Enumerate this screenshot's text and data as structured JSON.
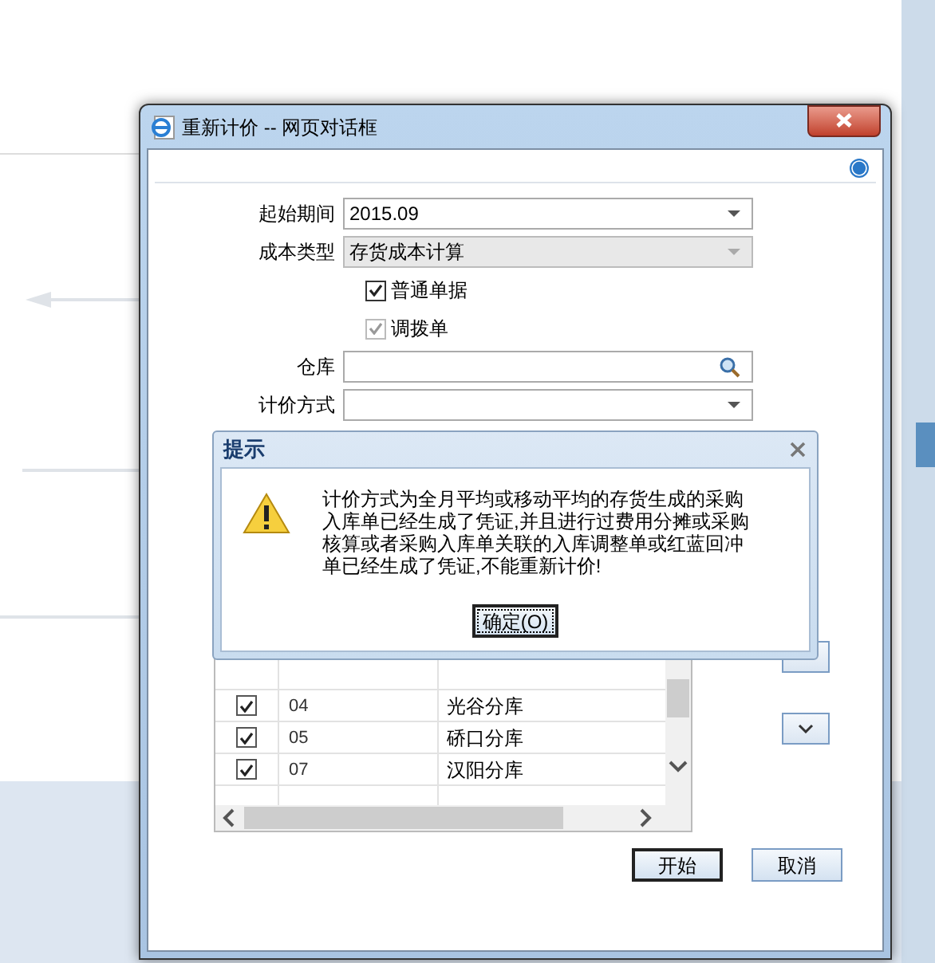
{
  "dialog": {
    "title": "重新计价 -- 网页对话框",
    "fields": [
      {
        "kind": "select",
        "label": "起始期间",
        "value": "2015.09",
        "disabled": false
      },
      {
        "kind": "select",
        "label": "成本类型",
        "value": "存货成本计算",
        "disabled": true
      },
      {
        "kind": "checkbox",
        "label": "普通单据",
        "checked": true,
        "disabled": false
      },
      {
        "kind": "checkbox",
        "label": "调拨单",
        "checked": true,
        "disabled": true
      },
      {
        "kind": "lookup",
        "label": "仓库"
      },
      {
        "kind": "select",
        "label": "计价方式"
      }
    ],
    "warehouses": [
      {
        "checked": true,
        "code": "04",
        "name": "光谷分库"
      },
      {
        "checked": true,
        "code": "05",
        "name": "硚口分库"
      },
      {
        "checked": true,
        "code": "07",
        "name": "汉阳分库"
      }
    ],
    "buttons": [
      "开始",
      "取消"
    ]
  },
  "alert": {
    "title": "提示",
    "message": "计价方式为全月平均或移动平均的存货生成的采购入库单已经生成了凭证,并且进行过费用分摊或采购核算或者采购入库单关联的入库调整单或红蓝回冲单已经生成了凭证,不能重新计价!",
    "button": "确定(O)"
  }
}
